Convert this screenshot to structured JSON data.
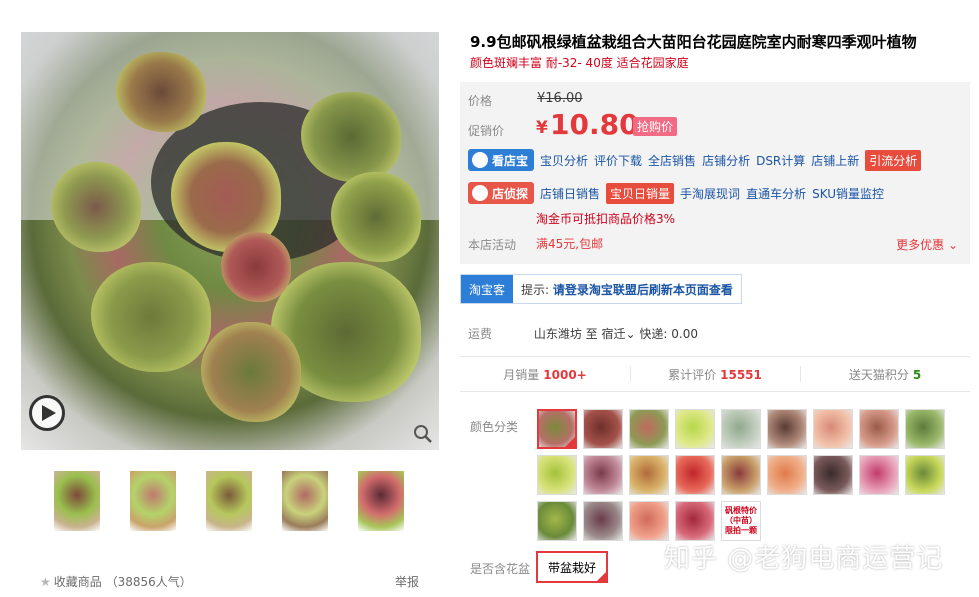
{
  "product": {
    "title": "9.9包邮矾根绿植盆栽组合大苗阳台花园庭院室内耐寒四季观叶植物",
    "subtitle": "颜色斑斓丰富 耐-32- 40度 适合花园家庭"
  },
  "gallery": {
    "play_icon": "play-icon",
    "zoom_icon": "zoom-icon",
    "thumbnails": [
      {
        "colors": [
          "#7b4a3a",
          "#9abf4d",
          "#c9b38f"
        ]
      },
      {
        "colors": [
          "#c07a70",
          "#b4d36a",
          "#c9a36b"
        ]
      },
      {
        "colors": [
          "#7a5a3a",
          "#b6c85c",
          "#c8b48a"
        ]
      },
      {
        "colors": [
          "#b06a62",
          "#c9d27c",
          "#9a7d5a"
        ]
      },
      {
        "colors": [
          "#5a2a35",
          "#d26c6c",
          "#a7c55a"
        ]
      }
    ],
    "favorite_label": "收藏商品",
    "favorite_count": "（38856人气）",
    "report_label": "举报"
  },
  "pricing": {
    "price_label": "价格",
    "original_price": "¥16.00",
    "promo_label": "促销价",
    "currency": "¥",
    "promo_price": "10.80",
    "promo_tag": "抢购价"
  },
  "tools": {
    "kandianbao": {
      "badge": "看店宝",
      "links": [
        {
          "label": "宝贝分析",
          "highlight": false
        },
        {
          "label": "评价下载",
          "highlight": false
        },
        {
          "label": "全店销售",
          "highlight": false
        },
        {
          "label": "店铺分析",
          "highlight": false
        },
        {
          "label": "DSR计算",
          "highlight": false
        },
        {
          "label": "店铺上新",
          "highlight": false
        },
        {
          "label": "引流分析",
          "highlight": true
        }
      ]
    },
    "dianxiabao": {
      "badge": "店侦探",
      "links": [
        {
          "label": "店铺日销售",
          "highlight": false
        },
        {
          "label": "宝贝日销量",
          "highlight": true
        },
        {
          "label": "手淘展现词",
          "highlight": false
        },
        {
          "label": "直通车分析",
          "highlight": false
        },
        {
          "label": "SKU销量监控",
          "highlight": false
        }
      ]
    },
    "coin_note": "淘金币可抵扣商品价格3%"
  },
  "shop_activity": {
    "label": "本店活动",
    "value": "满45元,包邮",
    "more": "更多优惠"
  },
  "taobaoke": {
    "badge": "淘宝客",
    "hint_prefix": "提示:",
    "hint_text": "请登录淘宝联盟后刷新本页面查看"
  },
  "shipping": {
    "label": "运费",
    "from": "山东潍坊",
    "to_word": "至",
    "destination": "宿迁",
    "method": "快递: 0.00"
  },
  "stats": {
    "monthly_sales_label": "月销量",
    "monthly_sales": "1000+",
    "reviews_label": "累计评价",
    "reviews": "15551",
    "points_label": "送天猫积分",
    "points": "5"
  },
  "options": {
    "color_label": "颜色分类",
    "swatches": [
      {
        "c1": "#7a8a3a",
        "c2": "#b57068",
        "selected": true
      },
      {
        "c1": "#6e2f2a",
        "c2": "#a4524a"
      },
      {
        "c1": "#c06a5e",
        "c2": "#8d9a55"
      },
      {
        "c1": "#b7d64a",
        "c2": "#dfe98a"
      },
      {
        "c1": "#8fa88c",
        "c2": "#c4cfc0"
      },
      {
        "c1": "#5a3a32",
        "c2": "#b08a7a"
      },
      {
        "c1": "#d78a78",
        "c2": "#f2c0a8"
      },
      {
        "c1": "#9a5a48",
        "c2": "#d79a8a"
      },
      {
        "c1": "#5d7a3a",
        "c2": "#9ab86a"
      },
      {
        "c1": "#a4c23a",
        "c2": "#d8e27a"
      },
      {
        "c1": "#7a3a4a",
        "c2": "#c28a9a"
      },
      {
        "c1": "#b06a3a",
        "c2": "#d9b46a"
      },
      {
        "c1": "#c0262a",
        "c2": "#e86a5a"
      },
      {
        "c1": "#8a3a3a",
        "c2": "#c9a06a"
      },
      {
        "c1": "#e07a4a",
        "c2": "#f0b08a"
      },
      {
        "c1": "#3a2a2a",
        "c2": "#7a5a5a"
      },
      {
        "c1": "#c23a6a",
        "c2": "#e8a0b8"
      },
      {
        "c1": "#6a8a3a",
        "c2": "#c8d85a"
      },
      {
        "c1": "#a3b84a",
        "c2": "#6a8a3a"
      },
      {
        "c1": "#6a3a4a",
        "c2": "#9a8a8a"
      },
      {
        "c1": "#d06a5a",
        "c2": "#f0a08a"
      },
      {
        "c1": "#a2283a",
        "c2": "#d86a7a"
      },
      {
        "text": "矾根特价（中苗）限拍一颗"
      }
    ],
    "pot_label": "是否含花盆",
    "pot_option": "带盆栽好"
  },
  "watermark": "知乎 @老狗电商运营记",
  "colors": {
    "accent_red": "#e4393c",
    "link_blue": "#1b55a5",
    "badge_blue": "#2d7ed6",
    "badge_orange": "#e8564a",
    "panel_bg": "#f3f3f3"
  }
}
